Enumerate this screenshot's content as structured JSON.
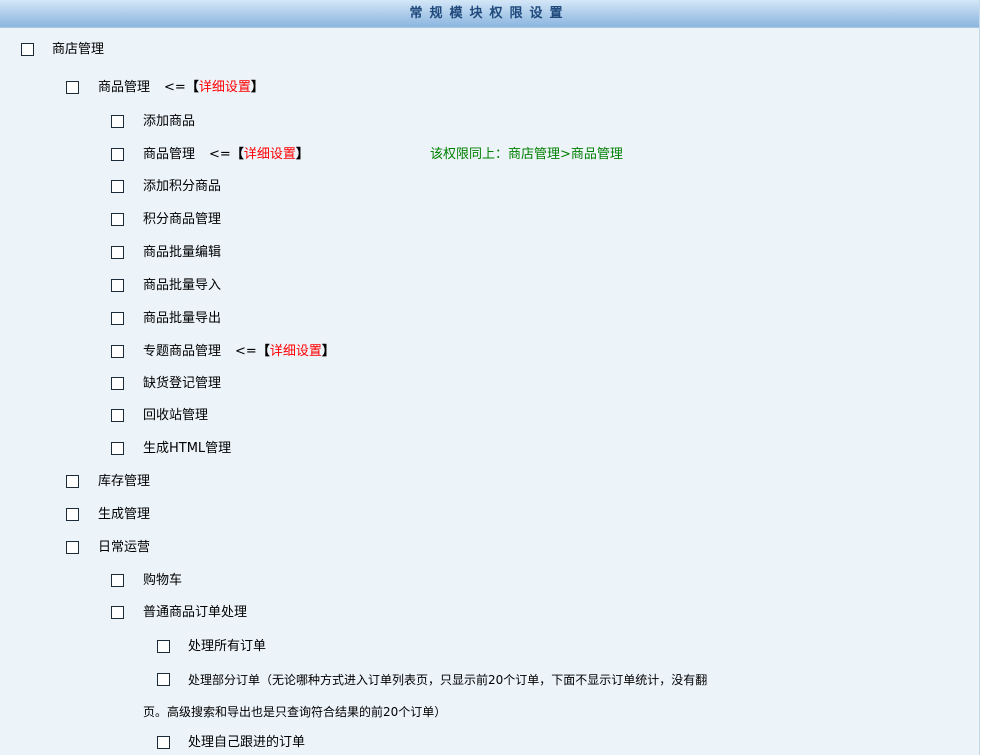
{
  "header": {
    "title": "常规模块权限设置"
  },
  "detail_link": {
    "arrow": "<=",
    "open": "【",
    "text": "详细设置",
    "close": "】"
  },
  "items": {
    "shop_mgmt": "商店管理",
    "goods_mgmt": "商品管理",
    "add_goods": "添加商品",
    "goods_mgmt_2": "商品管理",
    "goods_mgmt_2_note": "该权限同上：商店管理>商品管理",
    "add_points_goods": "添加积分商品",
    "points_goods_mgmt": "积分商品管理",
    "batch_edit": "商品批量编辑",
    "batch_import": "商品批量导入",
    "batch_export": "商品批量导出",
    "topic_goods_mgmt": "专题商品管理",
    "stockout_mgmt": "缺货登记管理",
    "recycle_mgmt": "回收站管理",
    "html_mgmt": "生成HTML管理",
    "stock_mgmt": "库存管理",
    "gen_mgmt": "生成管理",
    "daily_ops": "日常运营",
    "cart": "购物车",
    "order_processing": "普通商品订单处理",
    "process_all": "处理所有订单",
    "process_partial_line1": "处理部分订单（无论哪种方式进入订单列表页，只显示前20个订单，下面不显示订单统计，没有翻",
    "process_partial_line2": "页。高级搜索和导出也是只查询符合结果的前20个订单）",
    "process_own": "处理自己跟进的订单"
  }
}
